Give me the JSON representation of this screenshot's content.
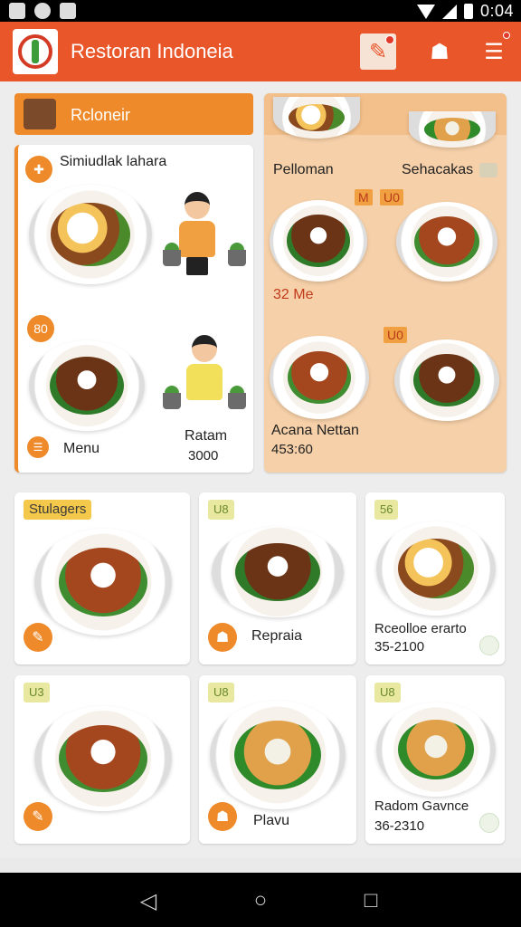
{
  "status_bar": {
    "time": "0:04",
    "icons": [
      "gallery-icon",
      "messenger-icon",
      "wifi-icon",
      "signal-icon",
      "battery-icon"
    ]
  },
  "app_bar": {
    "title": "Restoran Indoneia",
    "accent_color": "#e8562a",
    "actions": [
      "edit-icon",
      "chef-icon",
      "menu-icon"
    ]
  },
  "left_section": {
    "header_label": "Rcloneir",
    "card": {
      "title": "Simiudlak lahara",
      "badge_top": "80",
      "menu_label": "Menu",
      "rating_label": "Ratam",
      "rating_value": "3000"
    }
  },
  "right_section": {
    "label_left": "Pelloman",
    "label_right": "Sehacakas",
    "tag_1": "M",
    "tag_2": "U0",
    "mid_label": "32 Me",
    "tag_3": "U0",
    "bottom_name": "Acana Nettan",
    "bottom_price": "453:60"
  },
  "tiles": [
    {
      "tag": "Stulagers",
      "label": "",
      "price": ""
    },
    {
      "tag": "U8",
      "label": "Repraia",
      "price": ""
    },
    {
      "tag": "56",
      "label": "Rceolloe erarto",
      "price": "35-2100"
    },
    {
      "tag": "U3",
      "label": "",
      "price": ""
    },
    {
      "tag": "U8",
      "label": "Plavu",
      "price": ""
    },
    {
      "tag": "U8",
      "label": "Radom Gavnce",
      "price": "36-2310"
    }
  ],
  "nav": [
    "back-icon",
    "home-icon",
    "recents-icon"
  ]
}
